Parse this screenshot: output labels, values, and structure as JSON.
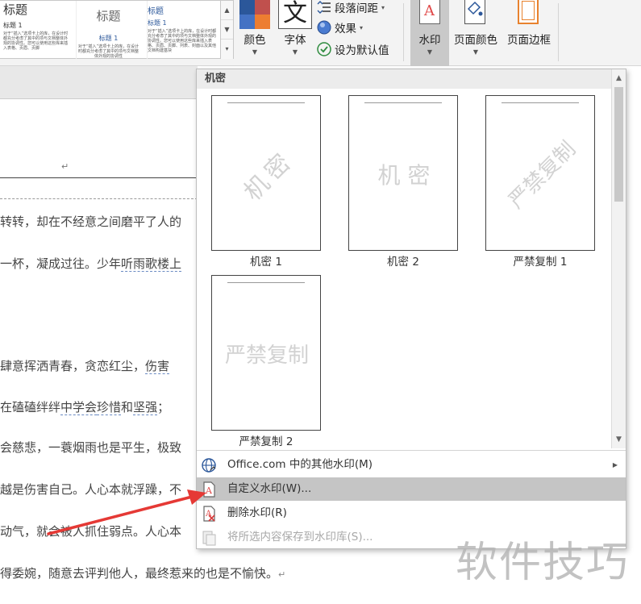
{
  "ribbon": {
    "styles": [
      {
        "heading": "标题",
        "subheading": "标题 1",
        "snippet": "对于“插入”选项卡上的库，在设计时都充分考虑了其中的项与文档整体外观的协调性。您可以使用这些库来插入表格、页眉、页脚"
      },
      {
        "heading": "标题",
        "subheading": "标题 1",
        "snippet": "对于“插入”选项卡上的库，在设计时都充分考虑了其中的项与文档整体外观的协调性"
      },
      {
        "heading": "标题",
        "subheading": "标题 1",
        "snippet": "对于“插入”选项卡上的库，在设计时都充分考虑了其中的项与文档整体外观的协调性。您可以使用这些库来插入表格、页眉、页脚、列表、封面以及其他文档构建基块"
      }
    ],
    "colors_label": "颜色",
    "font_label": "字体",
    "font_glyph": "文",
    "paragraph_spacing_label": "段落间距",
    "effects_label": "效果",
    "set_default_label": "设为默认值",
    "watermark_label": "水印",
    "page_color_label": "页面颜色",
    "page_border_label": "页面边框",
    "accent_colors": [
      "#2b579a",
      "#c0504d",
      "#9e9e9e",
      "#4472c4",
      "#ed7d31"
    ]
  },
  "document": {
    "cursor_mark": "↵",
    "lines": [
      {
        "parts": [
          {
            "t": "转转，却在不经意之间磨平了人的"
          }
        ]
      },
      {
        "parts": [
          {
            "t": "一杯，凝成过往。少年"
          },
          {
            "t": "听雨歌楼上",
            "u": true
          }
        ]
      },
      {
        "parts": [
          {
            "t": "肆意挥洒青春，贪恋红尘，"
          },
          {
            "t": "伤害",
            "u": true
          }
        ]
      },
      {
        "parts": [
          {
            "t": "   在磕磕绊绊"
          },
          {
            "t": "中学会",
            "u": true
          },
          {
            "t": "珍惜",
            "u": true
          },
          {
            "t": "和"
          },
          {
            "t": "坚强",
            "u": true
          },
          {
            "t": "；"
          }
        ]
      },
      {
        "parts": [
          {
            "t": "会慈悲，一蓑烟雨也是平生，极致"
          }
        ]
      },
      {
        "parts": [
          {
            "t": "越是伤害自己。人心本就浮躁，不"
          }
        ]
      },
      {
        "parts": [
          {
            "t": "动气，就会被人抓住弱点。人心本"
          }
        ]
      },
      {
        "parts": [
          {
            "t": "得委婉，随意去评判他人，最终惹来的也是不愉快。"
          },
          {
            "t": "↵",
            "m": true
          }
        ]
      }
    ]
  },
  "panel": {
    "category": "机密",
    "watermarks": [
      {
        "label": "机密 1",
        "text": "机密",
        "style": "diagonal"
      },
      {
        "label": "机密 2",
        "text": "机 密",
        "style": "horizontal"
      },
      {
        "label": "严禁复制 1",
        "text": "严禁复制",
        "style": "diagonal"
      },
      {
        "label": "严禁复制 2",
        "text": "严禁复制",
        "style": "horizontal"
      }
    ],
    "menu": [
      {
        "label": "Office.com 中的其他水印(M)",
        "icon": "globe-icon",
        "submenu": true
      },
      {
        "label": "自定义水印(W)...",
        "icon": "custom-watermark-icon",
        "active": true
      },
      {
        "label": "删除水印(R)",
        "icon": "delete-watermark-icon"
      },
      {
        "label": "将所选内容保存到水印库(S)...",
        "icon": "save-to-gallery-icon",
        "disabled": true
      }
    ]
  },
  "site_watermark": "软件技巧",
  "annotation_color": "#e53935"
}
